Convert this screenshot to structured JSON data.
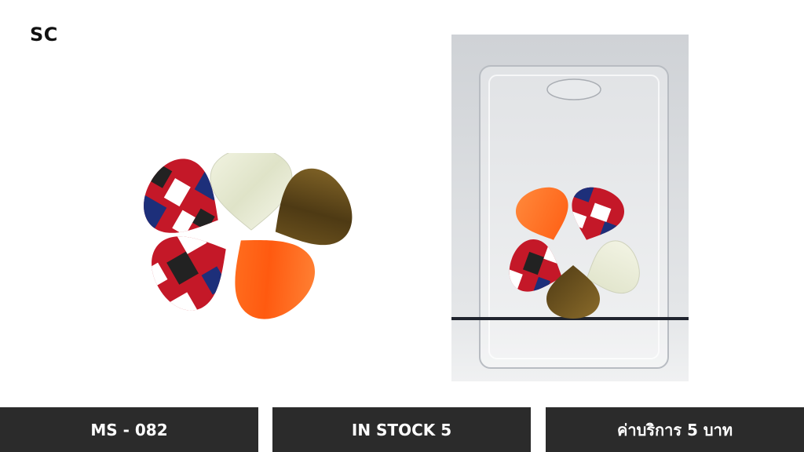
{
  "brand": {
    "logo_text": "SC"
  },
  "product": {
    "code": "MS - 082",
    "stock": "IN STOCK 5",
    "service_fee": "ค่าบริการ 5 บาท"
  },
  "images": {
    "loose_picks": [
      "pick-multicolor",
      "pick-pearl-white",
      "pick-brown-pearl",
      "pick-multicolor",
      "pick-orange-pearl"
    ],
    "packaged_picks": [
      "pick-orange-pearl",
      "pick-multicolor",
      "pick-multicolor",
      "pick-pearl-white",
      "pick-brown-pearl"
    ]
  },
  "colors": {
    "bar_background": "#2b2b2b",
    "bar_text": "#ffffff",
    "orange": "#ff6a1a",
    "pearl_white": "#e9ecd6",
    "brown": "#6a5320"
  }
}
